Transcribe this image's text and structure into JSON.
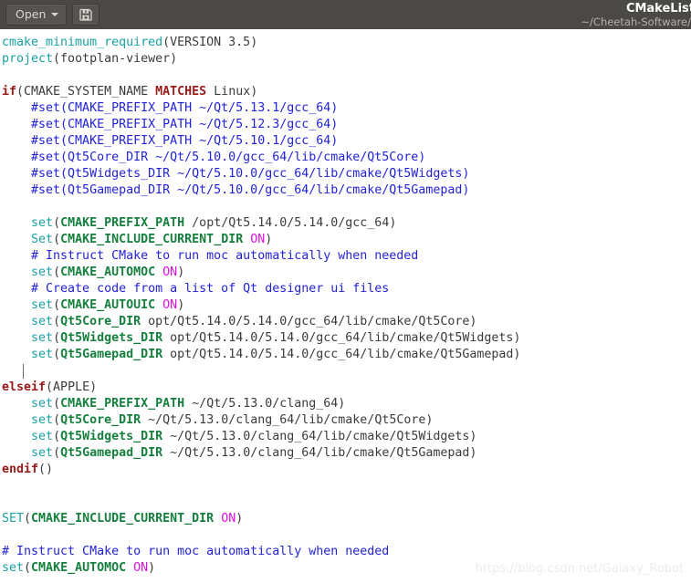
{
  "titlebar": {
    "open_button_label": "Open",
    "open_caret_icon": "chevron-down-icon",
    "save_as_icon": "save-as-floppy-icon",
    "document_title": "CMakeList",
    "document_path": "~/Cheetah-Software/f"
  },
  "editor": {
    "watermark": "https://blog.csdn.net/Galaxy_Robot",
    "cursor_line_index": 20,
    "colors": {
      "background": "#ffffff",
      "titlebar": "#4b4945",
      "command": "#1aa0a0",
      "keyword": "#9c1a1a",
      "variable": "#15803d",
      "constant": "#e012e0",
      "comment": "#2222dd",
      "plain": "#3b3b3b",
      "watermark": "#ececec"
    },
    "lines": [
      [
        {
          "t": "cmake_minimum_required",
          "c": "cmd"
        },
        {
          "t": "(VERSION 3.5)",
          "c": "pl"
        }
      ],
      [
        {
          "t": "project",
          "c": "cmd"
        },
        {
          "t": "(footplan-viewer)",
          "c": "pl"
        }
      ],
      [],
      [
        {
          "t": "if",
          "c": "kw"
        },
        {
          "t": "(CMAKE_SYSTEM_NAME ",
          "c": "pl"
        },
        {
          "t": "MATCHES",
          "c": "kw"
        },
        {
          "t": " Linux)",
          "c": "pl"
        }
      ],
      [
        {
          "t": "    #set(CMAKE_PREFIX_PATH ~/Qt/5.13.1/gcc_64)",
          "c": "cmt"
        }
      ],
      [
        {
          "t": "    #set(CMAKE_PREFIX_PATH ~/Qt/5.12.3/gcc_64)",
          "c": "cmt"
        }
      ],
      [
        {
          "t": "    #set(CMAKE_PREFIX_PATH ~/Qt/5.10.1/gcc_64)",
          "c": "cmt"
        }
      ],
      [
        {
          "t": "    #set(Qt5Core_DIR ~/Qt/5.10.0/gcc_64/lib/cmake/Qt5Core)",
          "c": "cmt"
        }
      ],
      [
        {
          "t": "    #set(Qt5Widgets_DIR ~/Qt/5.10.0/gcc_64/lib/cmake/Qt5Widgets)",
          "c": "cmt"
        }
      ],
      [
        {
          "t": "    #set(Qt5Gamepad_DIR ~/Qt/5.10.0/gcc_64/lib/cmake/Qt5Gamepad)",
          "c": "cmt"
        }
      ],
      [],
      [
        {
          "t": "    ",
          "c": "pl"
        },
        {
          "t": "set",
          "c": "cmd"
        },
        {
          "t": "(",
          "c": "pl"
        },
        {
          "t": "CMAKE_PREFIX_PATH",
          "c": "var"
        },
        {
          "t": " /opt/Qt5.14.0/5.14.0/gcc_64)",
          "c": "pl"
        }
      ],
      [
        {
          "t": "    ",
          "c": "pl"
        },
        {
          "t": "Set",
          "c": "cmd"
        },
        {
          "t": "(",
          "c": "pl"
        },
        {
          "t": "CMAKE_INCLUDE_CURRENT_DIR",
          "c": "var"
        },
        {
          "t": " ",
          "c": "pl"
        },
        {
          "t": "ON",
          "c": "on"
        },
        {
          "t": ")",
          "c": "pl"
        }
      ],
      [
        {
          "t": "    # Instruct CMake to run moc automatically when needed",
          "c": "cmt"
        }
      ],
      [
        {
          "t": "    ",
          "c": "pl"
        },
        {
          "t": "set",
          "c": "cmd"
        },
        {
          "t": "(",
          "c": "pl"
        },
        {
          "t": "CMAKE_AUTOMOC",
          "c": "var"
        },
        {
          "t": " ",
          "c": "pl"
        },
        {
          "t": "ON",
          "c": "on"
        },
        {
          "t": ")",
          "c": "pl"
        }
      ],
      [
        {
          "t": "    # Create code from a list of Qt designer ui files",
          "c": "cmt"
        }
      ],
      [
        {
          "t": "    ",
          "c": "pl"
        },
        {
          "t": "set",
          "c": "cmd"
        },
        {
          "t": "(",
          "c": "pl"
        },
        {
          "t": "CMAKE_AUTOUIC",
          "c": "var"
        },
        {
          "t": " ",
          "c": "pl"
        },
        {
          "t": "ON",
          "c": "on"
        },
        {
          "t": ")",
          "c": "pl"
        }
      ],
      [
        {
          "t": "    ",
          "c": "pl"
        },
        {
          "t": "set",
          "c": "cmd"
        },
        {
          "t": "(",
          "c": "pl"
        },
        {
          "t": "Qt5Core_DIR",
          "c": "var"
        },
        {
          "t": " opt/Qt5.14.0/5.14.0/gcc_64/lib/cmake/Qt5Core)",
          "c": "pl"
        }
      ],
      [
        {
          "t": "    ",
          "c": "pl"
        },
        {
          "t": "set",
          "c": "cmd"
        },
        {
          "t": "(",
          "c": "pl"
        },
        {
          "t": "Qt5Widgets_DIR",
          "c": "var"
        },
        {
          "t": " opt/Qt5.14.0/5.14.0/gcc_64/lib/cmake/Qt5Widgets)",
          "c": "pl"
        }
      ],
      [
        {
          "t": "    ",
          "c": "pl"
        },
        {
          "t": "set",
          "c": "cmd"
        },
        {
          "t": "(",
          "c": "pl"
        },
        {
          "t": "Qt5Gamepad_DIR",
          "c": "var"
        },
        {
          "t": " opt/Qt5.14.0/5.14.0/gcc_64/lib/cmake/Qt5Gamepad)",
          "c": "pl"
        }
      ],
      [],
      [
        {
          "t": "elseif",
          "c": "kw"
        },
        {
          "t": "(APPLE)",
          "c": "pl"
        }
      ],
      [
        {
          "t": "    ",
          "c": "pl"
        },
        {
          "t": "set",
          "c": "cmd"
        },
        {
          "t": "(",
          "c": "pl"
        },
        {
          "t": "CMAKE_PREFIX_PATH",
          "c": "var"
        },
        {
          "t": " ~/Qt/5.13.0/clang_64)",
          "c": "pl"
        }
      ],
      [
        {
          "t": "    ",
          "c": "pl"
        },
        {
          "t": "set",
          "c": "cmd"
        },
        {
          "t": "(",
          "c": "pl"
        },
        {
          "t": "Qt5Core_DIR",
          "c": "var"
        },
        {
          "t": " ~/Qt/5.13.0/clang_64/lib/cmake/Qt5Core)",
          "c": "pl"
        }
      ],
      [
        {
          "t": "    ",
          "c": "pl"
        },
        {
          "t": "set",
          "c": "cmd"
        },
        {
          "t": "(",
          "c": "pl"
        },
        {
          "t": "Qt5Widgets_DIR",
          "c": "var"
        },
        {
          "t": " ~/Qt/5.13.0/clang_64/lib/cmake/Qt5Widgets)",
          "c": "pl"
        }
      ],
      [
        {
          "t": "    ",
          "c": "pl"
        },
        {
          "t": "set",
          "c": "cmd"
        },
        {
          "t": "(",
          "c": "pl"
        },
        {
          "t": "Qt5Gamepad_DIR",
          "c": "var"
        },
        {
          "t": " ~/Qt/5.13.0/clang_64/lib/cmake/Qt5Gamepad)",
          "c": "pl"
        }
      ],
      [
        {
          "t": "endif",
          "c": "kw"
        },
        {
          "t": "()",
          "c": "pl"
        }
      ],
      [],
      [],
      [
        {
          "t": "SET",
          "c": "cmd"
        },
        {
          "t": "(",
          "c": "pl"
        },
        {
          "t": "CMAKE_INCLUDE_CURRENT_DIR",
          "c": "var"
        },
        {
          "t": " ",
          "c": "pl"
        },
        {
          "t": "ON",
          "c": "on"
        },
        {
          "t": ")",
          "c": "pl"
        }
      ],
      [],
      [
        {
          "t": "# Instruct CMake to run moc automatically when needed",
          "c": "cmt"
        }
      ],
      [
        {
          "t": "set",
          "c": "cmd"
        },
        {
          "t": "(",
          "c": "pl"
        },
        {
          "t": "CMAKE_AUTOMOC",
          "c": "var"
        },
        {
          "t": " ",
          "c": "pl"
        },
        {
          "t": "ON",
          "c": "on"
        },
        {
          "t": ")",
          "c": "pl"
        }
      ]
    ]
  }
}
